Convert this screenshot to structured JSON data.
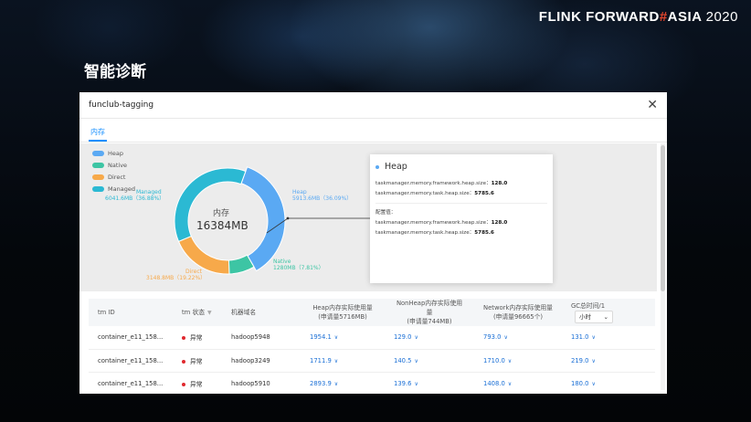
{
  "brand": {
    "part1": "FLINK FORWARD",
    "hash": "#",
    "part2": "ASIA",
    "year": "2020"
  },
  "slide_title": "智能诊断",
  "dialog": {
    "title": "funclub-tagging",
    "close": "✕",
    "tab": "内存"
  },
  "legend": [
    {
      "label": "Heap",
      "color": "#5aa9f3"
    },
    {
      "label": "Native",
      "color": "#3dc5a4"
    },
    {
      "label": "Direct",
      "color": "#f7a94a"
    },
    {
      "label": "Managed",
      "color": "#2bb9d3"
    }
  ],
  "donut": {
    "center_label": "内存",
    "center_value": "16384MB",
    "labels": {
      "heap_name": "Heap",
      "heap_value": "5913.6MB（36.09%）",
      "managed_name": "Managed",
      "managed_value": "6041.6MB（36.88%）",
      "direct_name": "Direct",
      "direct_value": "3148.8MB（19.22%）",
      "native_name": "Native",
      "native_value": "1280MB（7.81%）"
    }
  },
  "chart_data": {
    "type": "pie",
    "center": "16384MB",
    "slices": [
      {
        "name": "Heap",
        "value": 5913.6,
        "percent": 36.09,
        "color": "#5aa9f3"
      },
      {
        "name": "Native",
        "value": 1280,
        "percent": 7.81,
        "color": "#3dc5a4"
      },
      {
        "name": "Direct",
        "value": 3148.8,
        "percent": 19.22,
        "color": "#f7a94a"
      },
      {
        "name": "Managed",
        "value": 6041.6,
        "percent": 36.88,
        "color": "#2bb9d3"
      }
    ]
  },
  "tooltip": {
    "title": "Heap",
    "line1_key": "taskmanager.memory.framework.heap.size：",
    "line1_val": "128.0",
    "line2_key": "taskmanager.memory.task.heap.size：",
    "line2_val": "5785.6",
    "config_label": "配置值：",
    "line3_key": "taskmanager.memory.framework.heap.size：",
    "line3_val": "128.0",
    "line4_key": "taskmanager.memory.task.heap.size：",
    "line4_val": "5785.6"
  },
  "table": {
    "headers": {
      "tm_id": "tm ID",
      "tm_status": "tm 状态",
      "host": "机器域名",
      "heap_l1": "Heap内存实际使用量",
      "heap_l2": "(申请量5716MB)",
      "nonheap_l1": "NonHeap内存实际使用量",
      "nonheap_l2": "(申请量744MB)",
      "network_l1": "Network内存实际使用量",
      "network_l2": "(申请量96665个)",
      "gc": "GC总时间/1",
      "unit": "小时"
    },
    "rows": [
      {
        "id": "container_e11_158...",
        "status": "异常",
        "host": "hadoop5948",
        "heap": "1954.1",
        "nonheap": "129.0",
        "network": "793.0",
        "gc": "131.0"
      },
      {
        "id": "container_e11_158...",
        "status": "异常",
        "host": "hadoop3249",
        "heap": "1711.9",
        "nonheap": "140.5",
        "network": "1710.0",
        "gc": "219.0"
      },
      {
        "id": "container_e11_158...",
        "status": "异常",
        "host": "hadoop5910",
        "heap": "2893.9",
        "nonheap": "139.6",
        "network": "1408.0",
        "gc": "180.0"
      }
    ]
  },
  "icons": {
    "chevron": "∨",
    "filter": "▼",
    "dropdown": "⌄"
  }
}
